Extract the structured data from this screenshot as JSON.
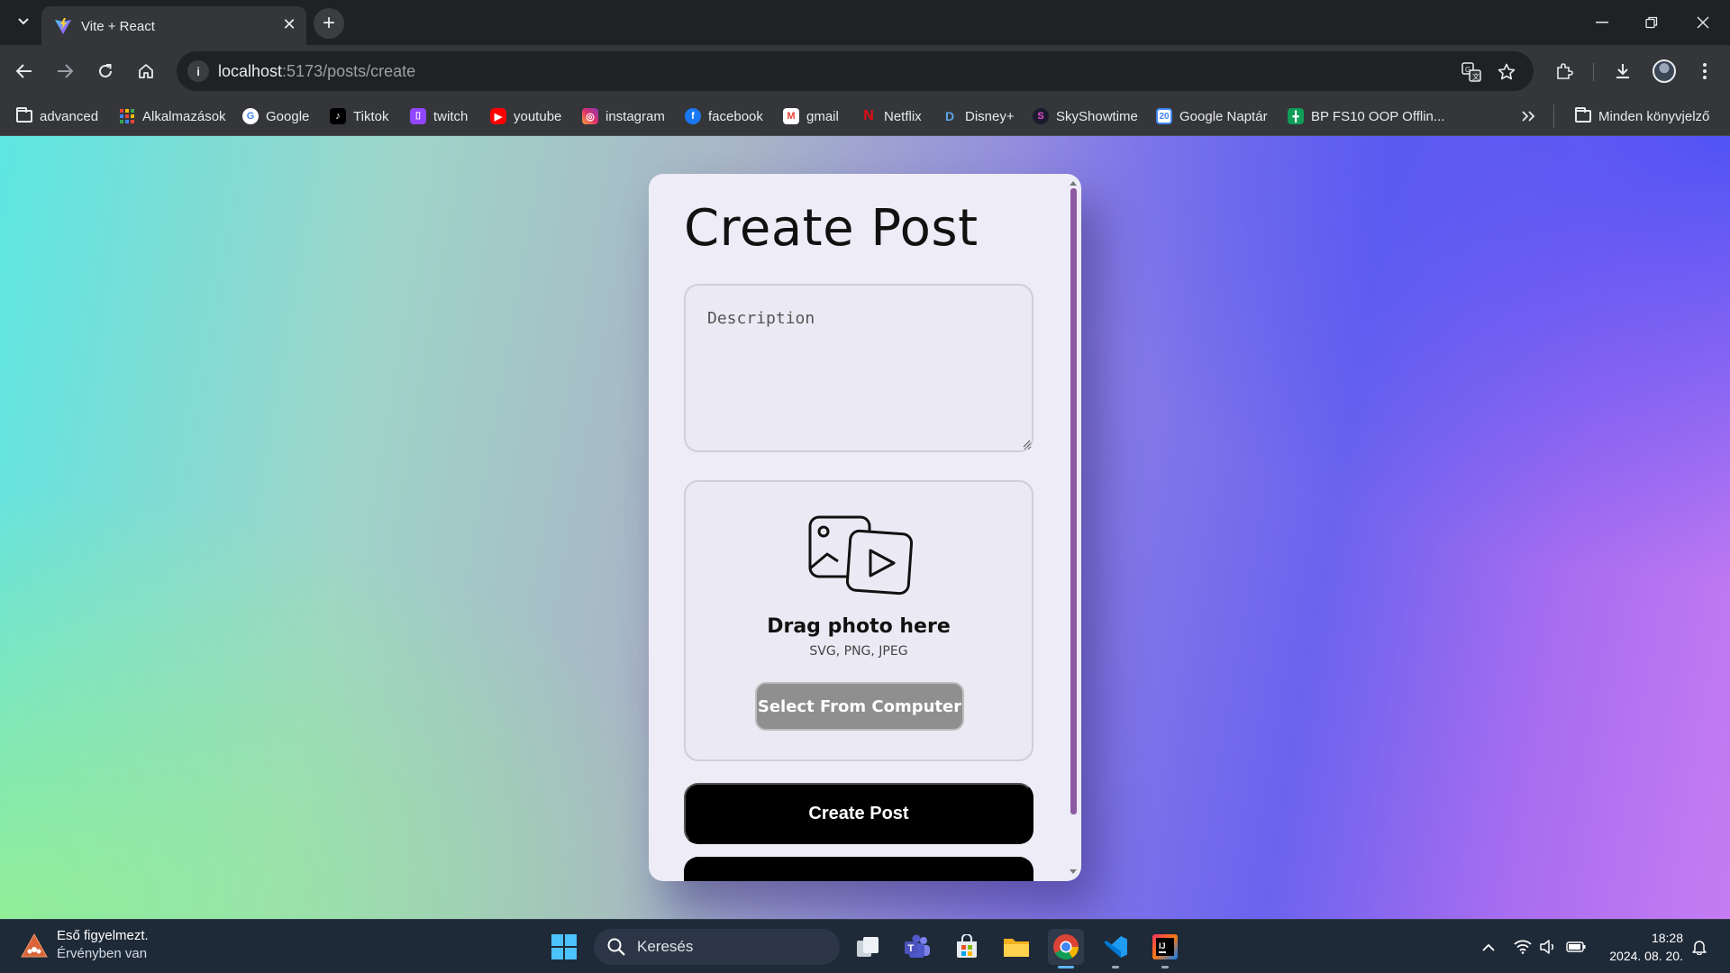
{
  "browser": {
    "tab_title": "Vite + React",
    "url_host": "localhost",
    "url_rest": ":5173/posts/create",
    "colors": {
      "frame": "#202124",
      "toolbar": "#35363a",
      "text": "#e8eaed"
    }
  },
  "bookmarks": [
    {
      "label": "advanced",
      "icon": "folder-icon"
    },
    {
      "label": "Alkalmazások",
      "icon": "apps-grid-icon"
    },
    {
      "label": "Google",
      "icon": "google-icon"
    },
    {
      "label": "Tiktok",
      "icon": "tiktok-icon"
    },
    {
      "label": "twitch",
      "icon": "twitch-icon"
    },
    {
      "label": "youtube",
      "icon": "youtube-icon"
    },
    {
      "label": "instagram",
      "icon": "instagram-icon"
    },
    {
      "label": "facebook",
      "icon": "facebook-icon"
    },
    {
      "label": "gmail",
      "icon": "gmail-icon"
    },
    {
      "label": "Netflix",
      "icon": "netflix-icon"
    },
    {
      "label": "Disney+",
      "icon": "disney-icon"
    },
    {
      "label": "SkyShowtime",
      "icon": "skyshowtime-icon"
    },
    {
      "label": "Google Naptár",
      "icon": "calendar-icon"
    },
    {
      "label": "BP FS10 OOP Offlin...",
      "icon": "sheets-icon"
    }
  ],
  "bookmarks_all": "Minden könyvjelző",
  "card": {
    "title": "Create Post",
    "description_placeholder": "Description",
    "drop_title": "Drag photo here",
    "drop_formats": "SVG, PNG, JPEG",
    "select_button": "Select From Computer",
    "create_button": "Create Post",
    "colors": {
      "card_bg": "#eeecf7",
      "button_bg": "#000000",
      "select_bg": "#8f8f8f",
      "scroll_thumb": "#8c5aa3"
    }
  },
  "taskbar": {
    "weather_title": "Eső figyelmezt.",
    "weather_subtitle": "Érvényben van",
    "search_placeholder": "Keresés",
    "time": "18:28",
    "date": "2024. 08. 20."
  }
}
